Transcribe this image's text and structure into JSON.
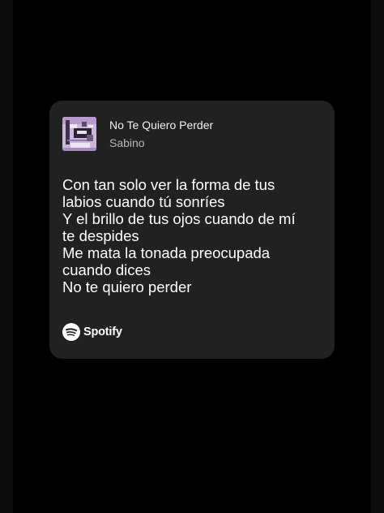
{
  "track": {
    "title": "No Te Quiero Perder",
    "artist": "Sabino"
  },
  "lyrics": [
    "Con tan solo ver la forma de tus",
    "labios cuando tú sonríes",
    "Y el brillo de tus ojos cuando de mí",
    "te despides",
    "Me mata la tonada preocupada",
    "cuando dices",
    "No te quiero perder"
  ],
  "brand": {
    "name": "Spotify",
    "icon": "spotify-logo-icon"
  },
  "colors": {
    "background": "#000000",
    "card": "#212121",
    "primary_text": "#ffffff",
    "secondary_text": "#b7b7b7",
    "art_tint": "#c9b4d8"
  }
}
